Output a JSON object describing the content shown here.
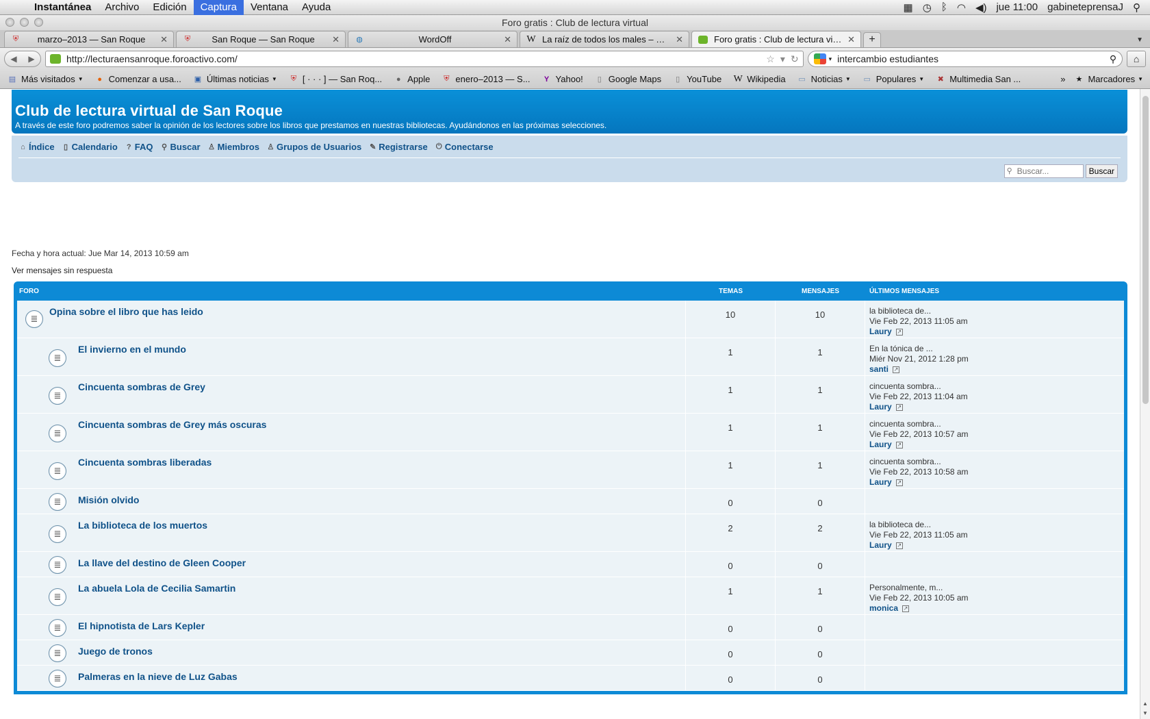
{
  "menubar": {
    "app_name": "Instantánea",
    "items": [
      "Archivo",
      "Edición",
      "Captura",
      "Ventana",
      "Ayuda"
    ],
    "active_item": "Captura",
    "clock": "jue 11:00",
    "user": "gabineteprensaJ"
  },
  "window": {
    "title": "Foro gratis : Club de lectura virtual"
  },
  "tabs": [
    {
      "label": "marzo–2013 — San Roque",
      "icon": "shield-icon"
    },
    {
      "label": "San Roque — San Roque",
      "icon": "shield-icon"
    },
    {
      "label": "WordOff",
      "icon": "globe-icon"
    },
    {
      "label": "La raíz de todos los males – Wi...",
      "icon": "wikipedia-icon"
    },
    {
      "label": "Foro gratis : Club de lectura virt...",
      "icon": "forum-icon"
    }
  ],
  "address": {
    "url": "http://lecturaensanroque.foroactivo.com/"
  },
  "search": {
    "query": "intercambio estudiantes"
  },
  "bookmarks": [
    {
      "label": "Más visitados",
      "caret": true,
      "icon": "folder-icon"
    },
    {
      "label": "Comenzar a usa...",
      "icon": "firefox-icon"
    },
    {
      "label": "Últimas noticias",
      "caret": true,
      "icon": "rss-icon"
    },
    {
      "label": "[ · · · ] — San Roq...",
      "icon": "shield-icon"
    },
    {
      "label": "Apple",
      "icon": "apple-icon"
    },
    {
      "label": "enero–2013 — S...",
      "icon": "shield-icon"
    },
    {
      "label": "Yahoo!",
      "icon": "yahoo-icon"
    },
    {
      "label": "Google Maps",
      "icon": "page-icon"
    },
    {
      "label": "YouTube",
      "icon": "page-icon"
    },
    {
      "label": "Wikipedia",
      "icon": "wikipedia-icon"
    },
    {
      "label": "Noticias",
      "caret": true,
      "icon": "folder-icon"
    },
    {
      "label": "Populares",
      "caret": true,
      "icon": "folder-icon"
    },
    {
      "label": "Multimedia San ...",
      "icon": "multimedia-icon"
    }
  ],
  "bookmarks_menu": {
    "label": "Marcadores"
  },
  "site": {
    "title": "Club de lectura virtual de San Roque",
    "description": "A través de este foro podremos saber la opinión de los lectores sobre los libros que prestamos en nuestras bibliotecas. Ayudándonos en las próximas selecciones.",
    "nav": [
      {
        "label": "Índice",
        "icon": "home-icon"
      },
      {
        "label": "Calendario",
        "icon": "calendar-icon"
      },
      {
        "label": "FAQ",
        "icon": "help-icon"
      },
      {
        "label": "Buscar",
        "icon": "search-icon"
      },
      {
        "label": "Miembros",
        "icon": "user-icon"
      },
      {
        "label": "Grupos de Usuarios",
        "icon": "group-icon"
      },
      {
        "label": "Registrarse",
        "icon": "register-icon"
      },
      {
        "label": "Conectarse",
        "icon": "power-icon"
      }
    ],
    "search_placeholder": "Buscar...",
    "search_button": "Buscar",
    "datetime": "Fecha y hora actual: Jue Mar 14, 2013 10:59 am",
    "unanswered": "Ver mensajes sin respuesta"
  },
  "forum": {
    "headers": {
      "forum": "FORO",
      "topics": "TEMAS",
      "posts": "MENSAJES",
      "last": "ÚLTIMOS MENSAJES"
    },
    "rows": [
      {
        "title": "Opina sobre el libro que has leido",
        "topics": "10",
        "posts": "10",
        "last_subject": "la biblioteca de...",
        "last_date": "Vie Feb 22, 2013 11:05 am",
        "last_author": "Laury",
        "parent": true
      },
      {
        "title": "El invierno en el mundo",
        "topics": "1",
        "posts": "1",
        "last_subject": "En la tónica de ...",
        "last_date": "Miér Nov 21, 2012 1:28 pm",
        "last_author": "santi"
      },
      {
        "title": "Cincuenta sombras de Grey",
        "topics": "1",
        "posts": "1",
        "last_subject": "cincuenta sombra...",
        "last_date": "Vie Feb 22, 2013 11:04 am",
        "last_author": "Laury"
      },
      {
        "title": "Cincuenta sombras de Grey más oscuras",
        "topics": "1",
        "posts": "1",
        "last_subject": "cincuenta sombra...",
        "last_date": "Vie Feb 22, 2013 10:57 am",
        "last_author": "Laury"
      },
      {
        "title": "Cincuenta sombras liberadas",
        "topics": "1",
        "posts": "1",
        "last_subject": "cincuenta sombra...",
        "last_date": "Vie Feb 22, 2013 10:58 am",
        "last_author": "Laury"
      },
      {
        "title": "Misión olvido",
        "topics": "0",
        "posts": "0"
      },
      {
        "title": "La biblioteca de los muertos",
        "topics": "2",
        "posts": "2",
        "last_subject": "la biblioteca de...",
        "last_date": "Vie Feb 22, 2013 11:05 am",
        "last_author": "Laury"
      },
      {
        "title": "La llave del destino de Gleen Cooper",
        "topics": "0",
        "posts": "0"
      },
      {
        "title": "La abuela Lola de Cecilia Samartin",
        "topics": "1",
        "posts": "1",
        "last_subject": "Personalmente, m...",
        "last_date": "Vie Feb 22, 2013 10:05 am",
        "last_author": "monica"
      },
      {
        "title": "El hipnotista de Lars Kepler",
        "topics": "0",
        "posts": "0"
      },
      {
        "title": "Juego de tronos",
        "topics": "0",
        "posts": "0"
      },
      {
        "title": "Palmeras en la nieve de Luz Gabas",
        "topics": "0",
        "posts": "0"
      }
    ]
  },
  "colors": {
    "accent": "#0d8ad6",
    "link": "#105289",
    "row_bg": "#ecf3f7",
    "nav_panel": "#cadcec"
  }
}
